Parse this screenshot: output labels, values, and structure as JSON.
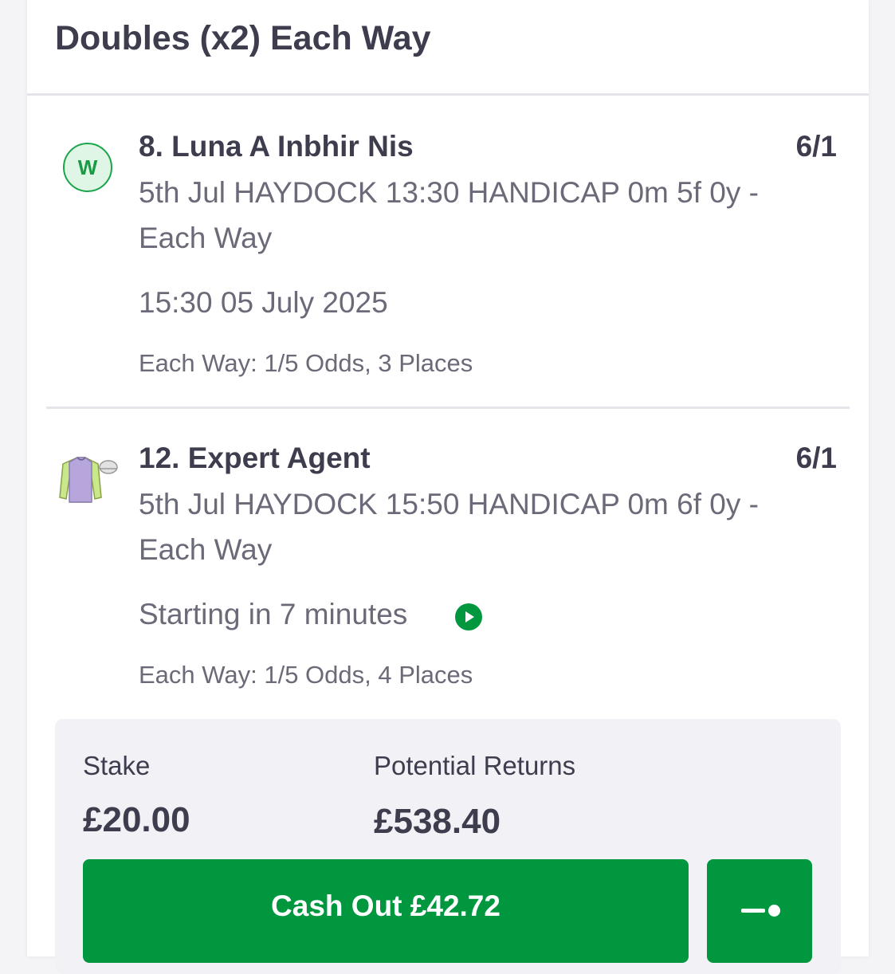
{
  "bet": {
    "title": "Doubles (x2) Each Way"
  },
  "selections": [
    {
      "badge": "W",
      "runner": "8. Luna A Inbhir Nis",
      "odds": "6/1",
      "event": "5th Jul HAYDOCK 13:30 HANDICAP 0m 5f 0y - Each Way",
      "time": "15:30 05 July 2025",
      "each_way": "Each Way: 1/5 Odds, 3 Places",
      "status_icon": "win-badge"
    },
    {
      "runner": "12. Expert Agent",
      "odds": "6/1",
      "event": "5th Jul HAYDOCK 15:50 HANDICAP 0m 6f 0y - Each Way",
      "time": "Starting in 7 minutes",
      "each_way": "Each Way: 1/5 Odds, 4 Places",
      "status_icon": "jockey-silks",
      "live_icon": "play-icon"
    }
  ],
  "summary": {
    "stake_label": "Stake",
    "stake_value": "£20.00",
    "returns_label": "Potential Returns",
    "returns_value": "£538.40",
    "cashout_label": "Cash Out £42.72",
    "partial_icon": "partial-cashout-slider-icon"
  },
  "colors": {
    "brand_green": "#00973f",
    "text_dark": "#3d3d4e",
    "text_muted": "#6a6a78"
  }
}
